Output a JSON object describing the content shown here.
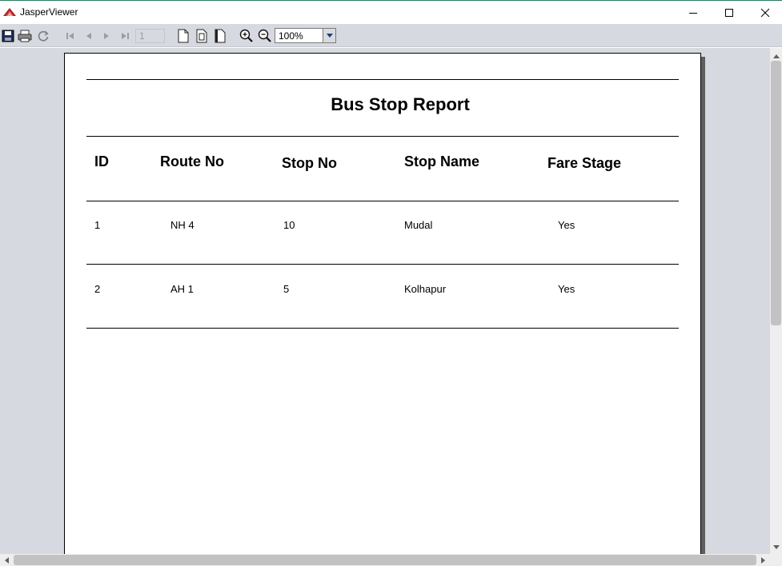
{
  "window": {
    "title": "JasperViewer",
    "icons": [
      "jasper-app-icon",
      "minimize-icon",
      "maximize-icon",
      "close-icon"
    ]
  },
  "toolbar": {
    "buttons": [
      "save-icon",
      "print-icon",
      "reload-icon",
      "first-page-icon",
      "previous-page-icon",
      "next-page-icon",
      "last-page-icon",
      "actual-size-icon",
      "fit-page-icon",
      "fit-width-icon",
      "zoom-in-icon",
      "zoom-out-icon"
    ],
    "page_number": "1",
    "zoom_value": "100%"
  },
  "report": {
    "title": "Bus Stop Report",
    "columns": [
      "ID",
      "Route No",
      "Stop No",
      "Stop Name",
      "Fare Stage"
    ],
    "rows": [
      [
        "1",
        "NH 4",
        "10",
        "Mudal",
        "Yes"
      ],
      [
        "2",
        "AH 1",
        "5",
        "Kolhapur",
        "Yes"
      ]
    ]
  },
  "colors": {
    "viewer_background": "#d6d9df",
    "page_background": "#ffffff",
    "scrollbar_thumb": "#c2c2c2"
  }
}
